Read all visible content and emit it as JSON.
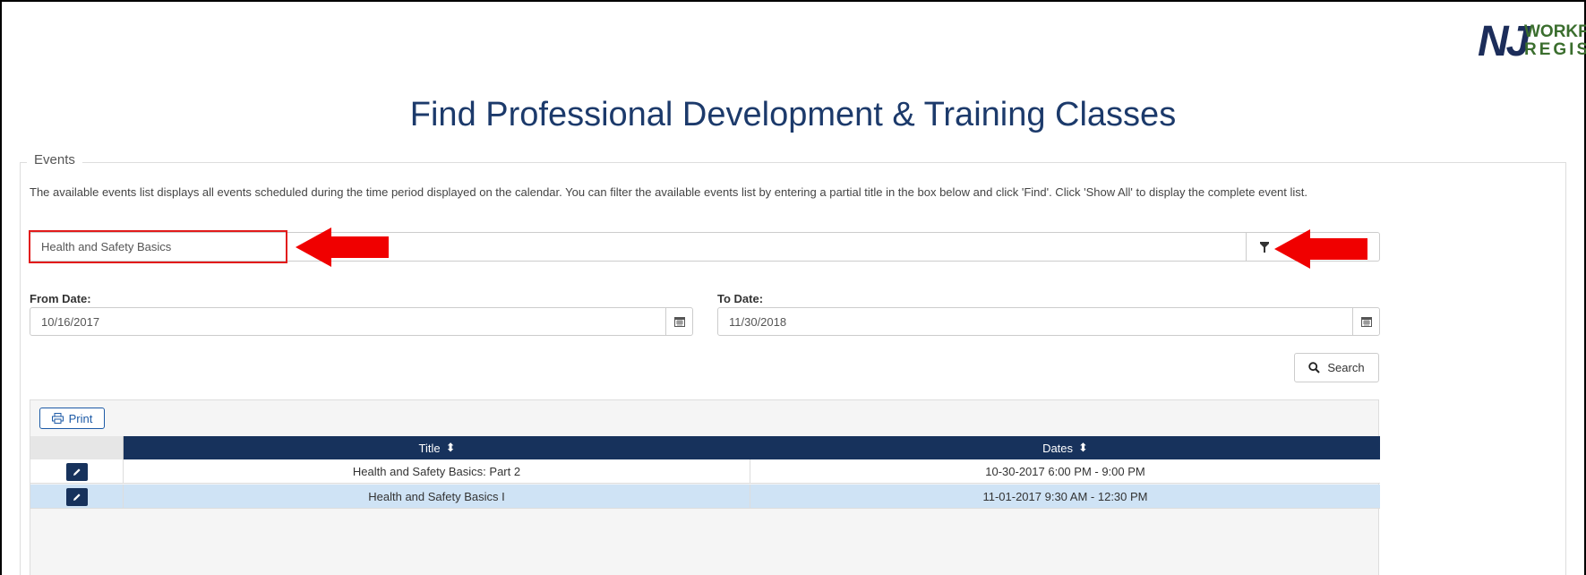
{
  "logo": {
    "nj": "NJ",
    "line1": "WORKFORCE",
    "line2": "REGISTRY"
  },
  "page_title": "Find Professional Development & Training Classes",
  "events_legend": "Events",
  "description": "The available events list displays all events scheduled during the time period displayed on the calendar. You can filter the available events list by entering a partial title in the box below and click 'Find'. Click 'Show All' to display the complete event list.",
  "filter": {
    "value": "Health and Safety Basics",
    "icon": "filter-icon"
  },
  "from_date": {
    "label": "From Date:",
    "value": "10/16/2017",
    "icon": "calendar-icon"
  },
  "to_date": {
    "label": "To Date:",
    "value": "11/30/2018",
    "icon": "calendar-icon"
  },
  "search_button": {
    "label": "Search",
    "icon": "search-icon"
  },
  "print_button": {
    "label": "Print",
    "icon": "printer-icon"
  },
  "table": {
    "columns": [
      "Title",
      "Dates"
    ],
    "rows": [
      {
        "title": "Health and Safety Basics: Part 2",
        "dates": "10-30-2017 6:00 PM - 9:00 PM"
      },
      {
        "title": "Health and Safety Basics I",
        "dates": "11-01-2017 9:30 AM - 12:30 PM"
      }
    ]
  },
  "colors": {
    "annotation_red": "#f00000",
    "header_navy": "#17325c",
    "title_blue": "#1c3a6b",
    "selected_row": "#cfe3f5"
  }
}
